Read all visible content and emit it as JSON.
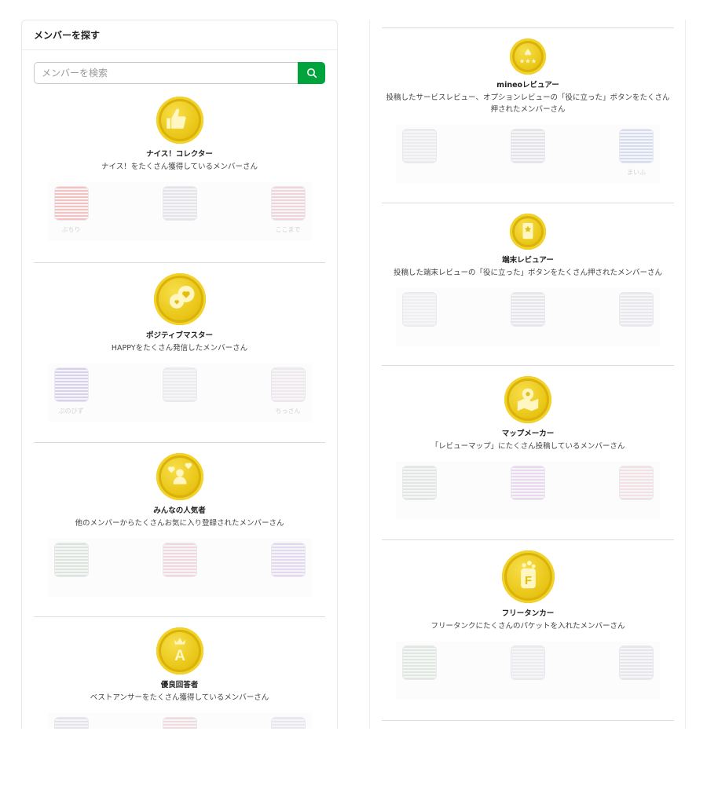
{
  "panel": {
    "title": "メンバーを探す"
  },
  "search": {
    "placeholder": "メンバーを検索",
    "icon": "search-icon"
  },
  "colors": {
    "accent": "#00a33c",
    "medal": "#e8c41a"
  },
  "left_badges": [
    {
      "name": "ナイス！コレクター",
      "description": "ナイス！をたくさん獲得しているメンバーさん",
      "icon": "thumbs-up-icon",
      "members": [
        {
          "name": "ぶちり",
          "tint": "#f3c2c0"
        },
        {
          "name": "",
          "tint": "#e4e4e8"
        },
        {
          "name": "ここまで",
          "tint": "#efd4d8"
        }
      ]
    },
    {
      "name": "ポジティブマスター",
      "description": "HAPPYをたくさん発信したメンバーさん",
      "icon": "hearts-icon",
      "members": [
        {
          "name": "ぷのびず",
          "tint": "#d8d0ee"
        },
        {
          "name": "",
          "tint": "#ececef"
        },
        {
          "name": "ちっさん",
          "tint": "#efe9ee"
        }
      ]
    },
    {
      "name": "みんなの人気者",
      "description": "他のメンバーからたくさんお気に入り登録されたメンバーさん",
      "icon": "people-hearts-icon",
      "members": [
        {
          "name": "",
          "tint": "#dbe5dc"
        },
        {
          "name": "",
          "tint": "#f1d8de"
        },
        {
          "name": "",
          "tint": "#e2d9ee"
        }
      ]
    },
    {
      "name": "優良回答者",
      "description": "ベストアンサーをたくさん獲得しているメンバーさん",
      "icon": "crown-a-icon",
      "members": [
        {
          "name": "",
          "tint": "#e4e4e8"
        },
        {
          "name": "",
          "tint": "#efdadd"
        },
        {
          "name": "",
          "tint": "#e8e8ec"
        }
      ]
    }
  ],
  "right_badges": [
    {
      "name": "mineoレビュアー",
      "description": "投稿したサービスレビュー、オプションレビューの「役に立った」ボタンをたくさん押されたメンバーさん",
      "icon": "review-stars-icon",
      "members": [
        {
          "name": "",
          "tint": "#ececef"
        },
        {
          "name": "",
          "tint": "#e4e4e8"
        },
        {
          "name": "まいふ",
          "tint": "#d5dcf0"
        }
      ]
    },
    {
      "name": "端末レビュアー",
      "description": "投稿した端末レビューの「役に立った」ボタンをたくさん押されたメンバーさん",
      "icon": "phone-star-icon",
      "members": [
        {
          "name": "",
          "tint": "#efeff2"
        },
        {
          "name": "",
          "tint": "#e6e6ea"
        },
        {
          "name": "",
          "tint": "#e9e9ed"
        }
      ]
    },
    {
      "name": "マップメーカー",
      "description": "「レビューマップ」にたくさん投稿しているメンバーさん",
      "icon": "map-pin-icon",
      "members": [
        {
          "name": "",
          "tint": "#e2e6e3"
        },
        {
          "name": "",
          "tint": "#ead8ee"
        },
        {
          "name": "",
          "tint": "#f2e0e3"
        }
      ]
    },
    {
      "name": "フリータンカー",
      "description": "フリータンクにたくさんのパケットを入れたメンバーさん",
      "icon": "tank-f-icon",
      "members": [
        {
          "name": "",
          "tint": "#dee8de"
        },
        {
          "name": "",
          "tint": "#ececef"
        },
        {
          "name": "",
          "tint": "#e7e7eb"
        }
      ]
    }
  ]
}
